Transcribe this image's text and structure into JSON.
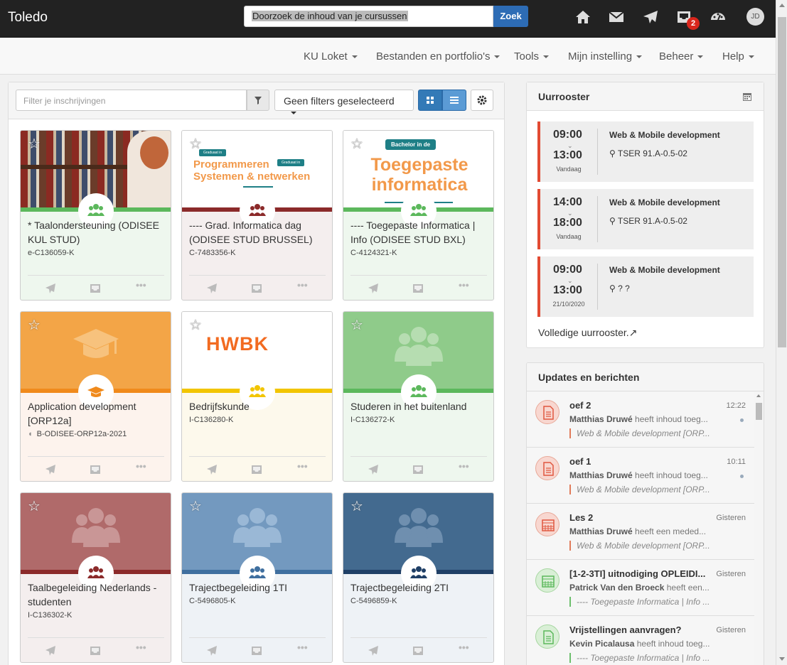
{
  "app": {
    "title": "Toledo"
  },
  "search": {
    "value": "Doorzoek de inhoud van je cursussen",
    "button": "Zoek"
  },
  "topbar": {
    "inbox_badge": "2",
    "avatar_initials": "JD"
  },
  "nav": [
    "KU Loket",
    "Bestanden en portfolio's",
    "Tools",
    "Mijn instelling",
    "Beheer",
    "Help"
  ],
  "filters": {
    "placeholder": "Filter je inschrijvingen",
    "dropdown": "Geen filters geselecteerd"
  },
  "banners": {
    "hwbk": "HWBK",
    "toegepaste_badge": "Bachelor in de",
    "toegepaste": "Toegepaste informatica",
    "prog_tag1": "Graduaat in",
    "prog_tag2": "Graduaat in",
    "prog_title1": "Programmeren",
    "prog_title2": "Systemen & netwerken"
  },
  "courses": [
    {
      "title": "* Taalondersteuning (ODISEE KUL STUD)",
      "code": "e-C136059-K"
    },
    {
      "title": "---- Grad. Informatica dag (ODISEE STUD BRUSSEL)",
      "code": "C-7483356-K"
    },
    {
      "title": "---- Toegepaste Informatica | Info (ODISEE STUD BXL)",
      "code": "C-4124321-K"
    },
    {
      "title": "Application development [ORP12a]",
      "code": "B-ODISEE-ORP12a-2021"
    },
    {
      "title": "Bedrijfskunde",
      "code": "I-C136280-K"
    },
    {
      "title": "Studeren in het buitenland",
      "code": "I-C136272-K"
    },
    {
      "title": "Taalbegeleiding Nederlands - studenten",
      "code": "I-C136302-K"
    },
    {
      "title": "Trajectbegeleiding 1TI",
      "code": "C-5496805-K"
    },
    {
      "title": "Trajectbegeleiding 2TI",
      "code": "C-5496859-K"
    }
  ],
  "schedule": {
    "title": "Uurrooster",
    "slots": [
      {
        "start": "09:00",
        "end": "13:00",
        "day": "Vandaag",
        "course": "Web & Mobile development",
        "location": "TSER 91.A-0.5-02"
      },
      {
        "start": "14:00",
        "end": "18:00",
        "day": "Vandaag",
        "course": "Web & Mobile development",
        "location": "TSER 91.A-0.5-02"
      },
      {
        "start": "09:00",
        "end": "13:00",
        "day": "21/10/2020",
        "course": "Web & Mobile development",
        "location": "? ?"
      }
    ],
    "full_link": "Volledige uurrooster."
  },
  "updates": {
    "title": "Updates en berichten",
    "items": [
      {
        "title": "oef 2",
        "when": "12:22",
        "author": "Matthias Druwé",
        "action": "heeft inhoud toeg...",
        "course": "Web & Mobile development [ORP..."
      },
      {
        "title": "oef 1",
        "when": "10:11",
        "author": "Matthias Druwé",
        "action": "heeft inhoud toeg...",
        "course": "Web & Mobile development [ORP..."
      },
      {
        "title": "Les 2",
        "when": "Gisteren",
        "author": "Matthias Druwé",
        "action": "heeft een meded...",
        "course": "Web & Mobile development [ORP..."
      },
      {
        "title": "[1-2-3TI] uitnodiging OPLEIDI...",
        "when": "Gisteren",
        "author": "Patrick Van den Broeck",
        "action": "heeft een...",
        "course": "---- Toegepaste Informatica | Info ..."
      },
      {
        "title": "Vrijstellingen aanvragen?",
        "when": "Gisteren",
        "author": "Kevin Picalausa",
        "action": "heeft inhoud toeg...",
        "course": "---- Toegepaste Informatica | Info ..."
      }
    ]
  },
  "colors": {
    "topbar": "#222222",
    "accent": "#2d6cb5",
    "green": "#5cb85c",
    "orange": "#f0ad4e",
    "red": "#e24a33"
  }
}
